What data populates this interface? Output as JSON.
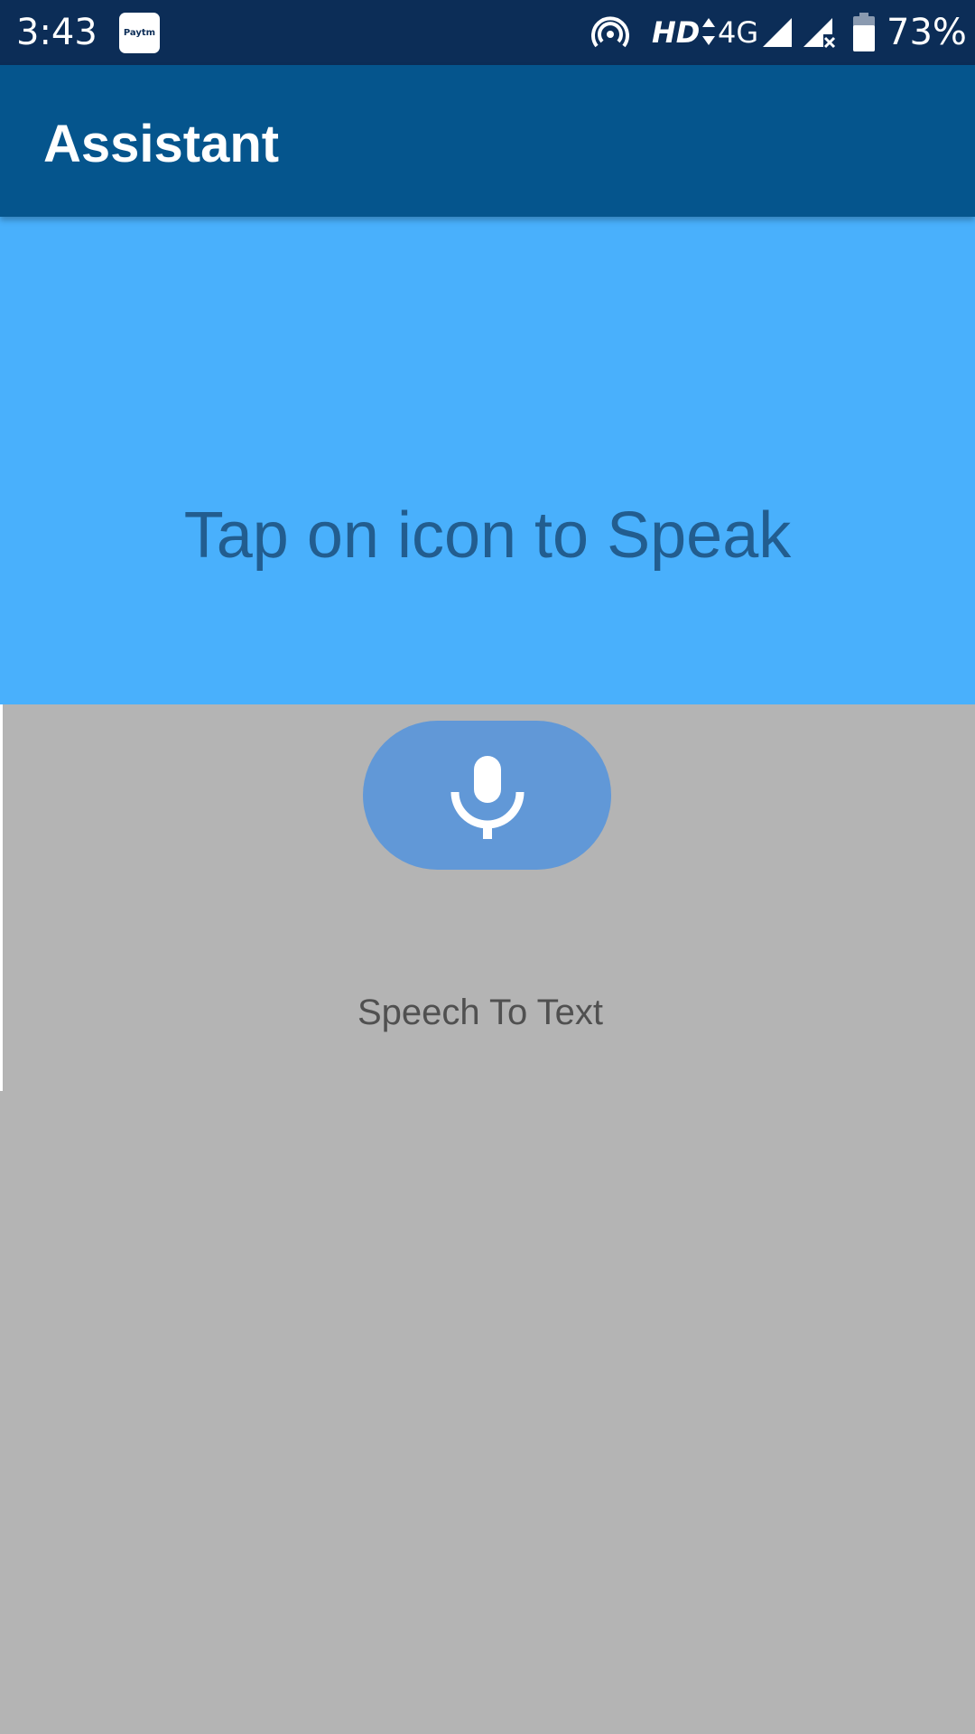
{
  "status_bar": {
    "time": "3:43",
    "app_icon_label": "Paytm",
    "network_quality": "HD",
    "network_type": "4G",
    "battery_percent": "73%",
    "icons": [
      "paytm-icon",
      "hotspot-icon",
      "data-activity-icon",
      "signal-icon",
      "signal-no-sim-icon",
      "battery-icon"
    ]
  },
  "app_bar": {
    "title": "Assistant"
  },
  "main": {
    "prompt": "Tap on icon to Speak",
    "mic_icon": "microphone-icon",
    "caption": "Speech To Text"
  },
  "colors": {
    "status_bar": "#0c2d57",
    "app_bar": "#05558d",
    "hero_circle": "#49b0fc",
    "prompt_text": "#225d8f",
    "mic_button": "#6198d7",
    "background": "#b4b4b4"
  }
}
